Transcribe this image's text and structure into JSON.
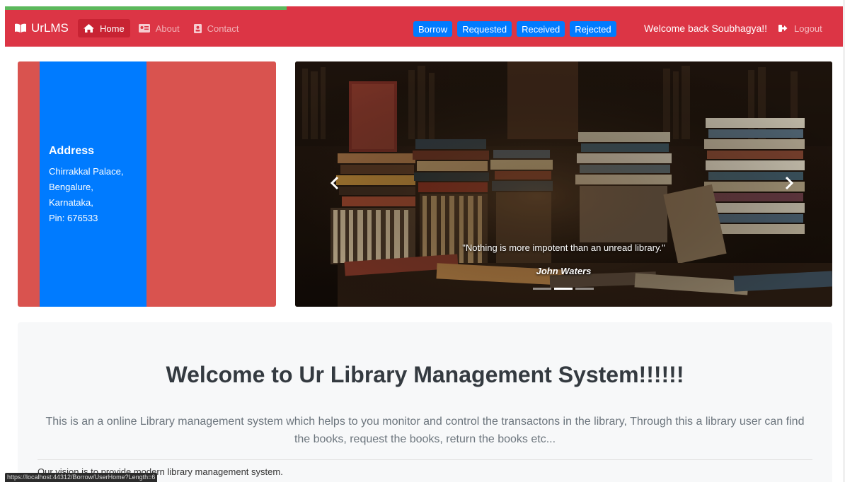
{
  "navbar": {
    "brand": "UrLMS",
    "links": [
      {
        "label": "Home"
      },
      {
        "label": "About"
      },
      {
        "label": "Contact"
      }
    ],
    "actions": [
      "Borrow",
      "Requested",
      "Received",
      "Rejected"
    ],
    "welcome": "Welcome back Soubhagya!!",
    "logout": "Logout"
  },
  "progress": {
    "fraction": 0.335,
    "fill_color": "#5cb85c",
    "track_color": "#dc3545"
  },
  "address": {
    "title": "Address",
    "lines": [
      "Chirrakkal Palace,",
      "Bengalure,",
      "Karnataka,",
      "Pin: 676533"
    ]
  },
  "carousel": {
    "quote": "\"Nothing is more impotent than an unread library.\"",
    "author": "John Waters",
    "indicator_count": 3,
    "active_indicator": 1
  },
  "jumbotron": {
    "title": "Welcome to Ur Library Management System!!!!!!",
    "lead": "This is an a online Library management system which helps to you monitor and control the transactons in the library, Through this a library user can find the books, request the books, return the books etc...",
    "text": "Our vision is to provide modern library management system."
  },
  "status_url": "https://localhost:44312/Borrow/UserHome?Length=6",
  "colors": {
    "navbar": "#dc3545",
    "primary": "#007bff",
    "address_bg": "#d9534f"
  },
  "icons": {
    "brand": "book-open-icon",
    "home": "home-icon",
    "about": "id-card-icon",
    "contact": "contact-book-icon",
    "logout": "sign-out-icon",
    "prev": "chevron-left-icon",
    "next": "chevron-right-icon"
  }
}
